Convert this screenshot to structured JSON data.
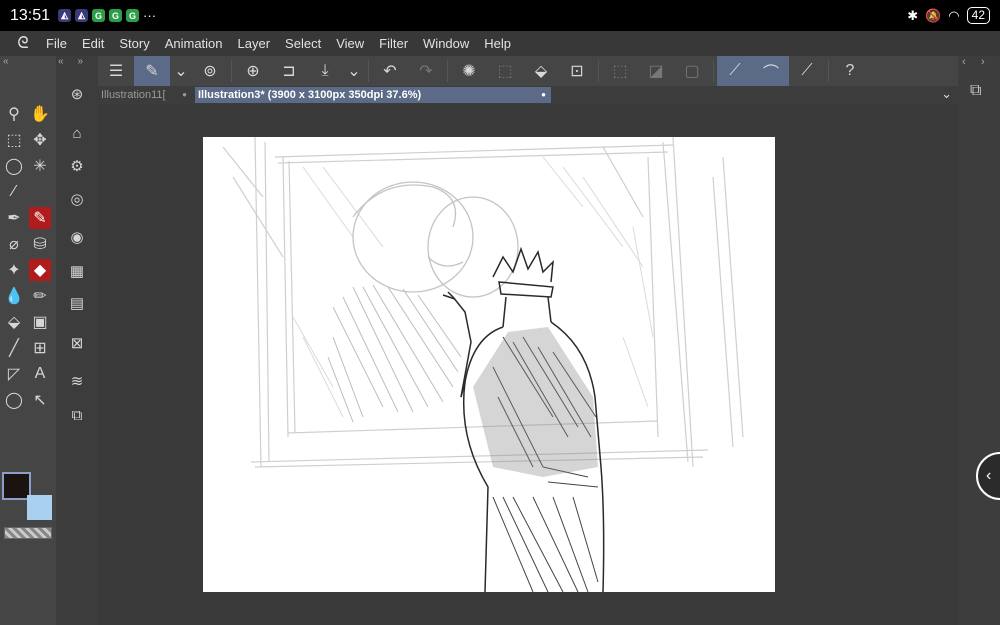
{
  "status": {
    "time": "13:51",
    "icons": [
      "tile-icon",
      "tile-icon",
      "green-square-icon",
      "green-square-icon",
      "green-square-icon"
    ],
    "more": "···",
    "battery": "42"
  },
  "menu": [
    "File",
    "Edit",
    "Story",
    "Animation",
    "Layer",
    "Select",
    "View",
    "Filter",
    "Window",
    "Help"
  ],
  "tabs": [
    {
      "label": "Illustration11["
    },
    {
      "label": "Illustration3* (3900 x 3100px 350dpi 37.6%)"
    }
  ],
  "colors": {
    "accent": "#5b6a86",
    "active_tool": "#b01c1c",
    "foreground": "#1a1310",
    "background": "#a9d0ee"
  }
}
